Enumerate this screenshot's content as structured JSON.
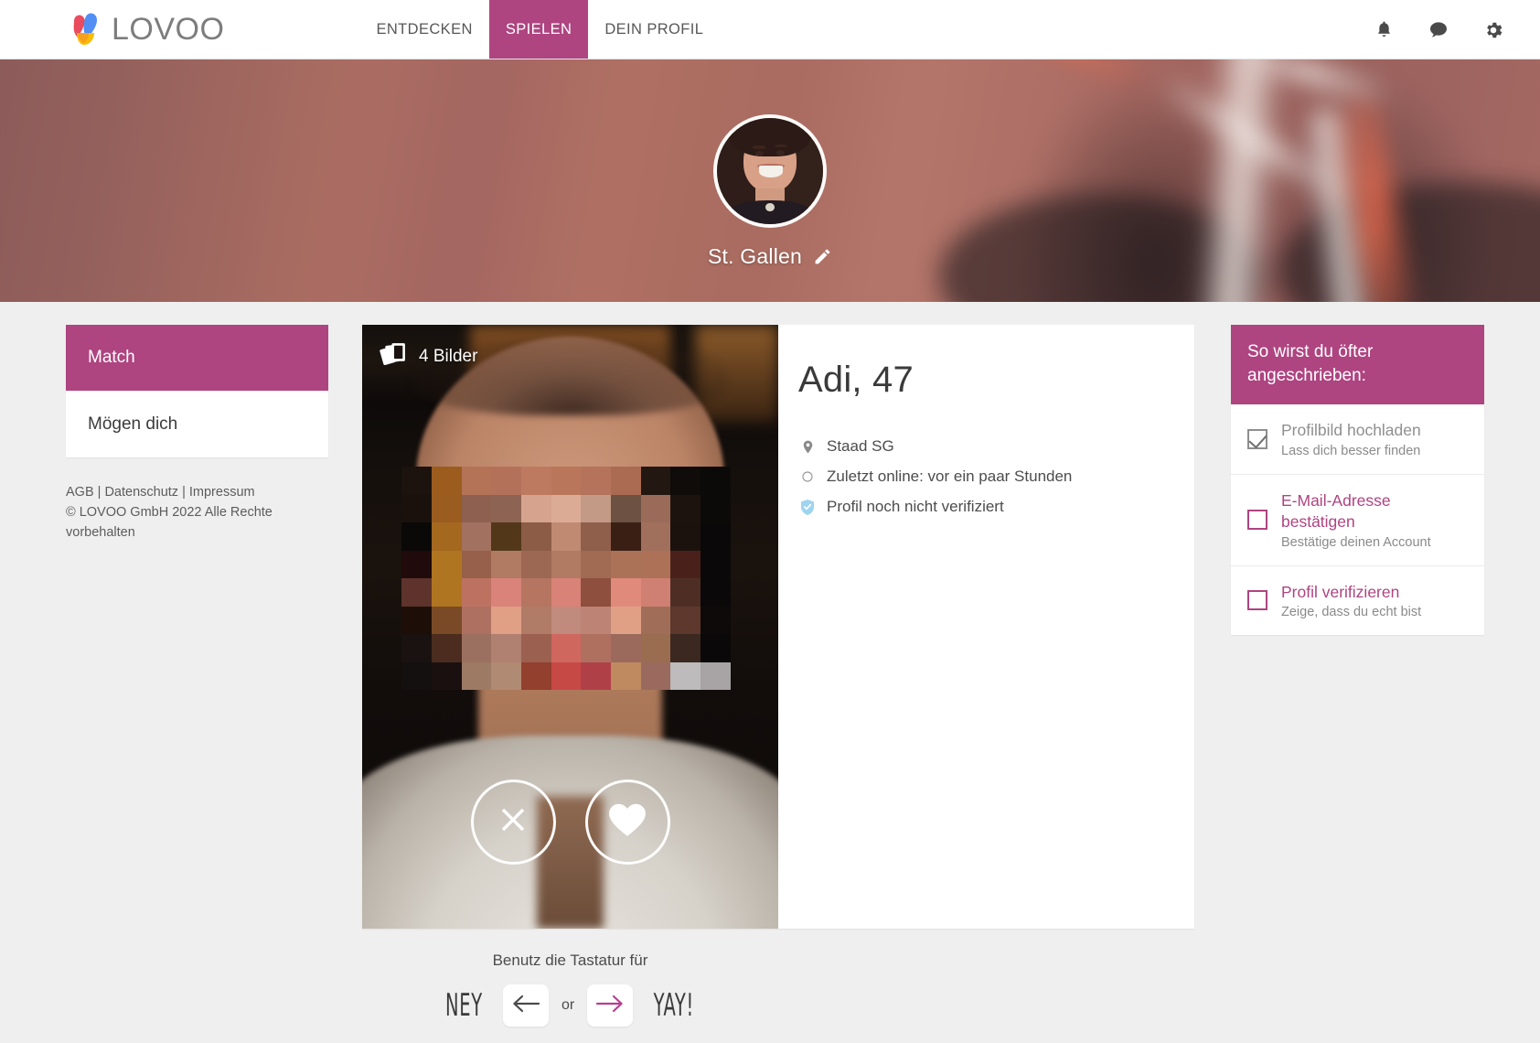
{
  "brand": {
    "name": "LOVOO",
    "accent": "#ae4480",
    "logo_icon": "lovoo-logo-icon"
  },
  "topnav": {
    "items": [
      {
        "label": "ENTDECKEN",
        "active": false
      },
      {
        "label": "SPIELEN",
        "active": true
      },
      {
        "label": "DEIN PROFIL",
        "active": false
      }
    ],
    "icons": [
      {
        "name": "notifications-bell-icon"
      },
      {
        "name": "chat-bubble-icon"
      },
      {
        "name": "settings-gear-icon"
      }
    ]
  },
  "hero": {
    "location": "St. Gallen",
    "edit_icon": "pencil-edit-icon",
    "avatar_icon": "user-avatar"
  },
  "sidebar": {
    "items": [
      {
        "label": "Match",
        "active": true
      },
      {
        "label": "Mögen dich",
        "active": false
      }
    ],
    "legal_links": [
      "AGB",
      "Datenschutz",
      "Impressum"
    ],
    "legal_separator": " | ",
    "copyright": "© LOVOO GmbH 2022 Alle Rechte vorbehalten"
  },
  "card": {
    "photo_badge": {
      "icon": "photo-stack-icon",
      "label": "4 Bilder"
    },
    "actions": {
      "dislike_icon": "close-x-icon",
      "like_icon": "heart-icon"
    },
    "profile": {
      "name_age": "Adi, 47",
      "details": [
        {
          "icon": "location-pin-icon",
          "text": "Staad SG"
        },
        {
          "icon": "clock-circle-icon",
          "text": "Zuletzt online: vor ein paar Stunden"
        },
        {
          "icon": "shield-check-icon",
          "text": "Profil noch nicht verifiziert"
        }
      ]
    }
  },
  "keyboard_hint": {
    "text": "Benutz die Tastatur für",
    "left_word": "NEY",
    "left_key_icon": "arrow-left-icon",
    "or_label": "or",
    "right_key_icon": "arrow-right-icon",
    "right_word": "YAY!"
  },
  "checklist": {
    "title": "So wirst du öfter angeschrieben:",
    "items": [
      {
        "title": "Profilbild hochladen",
        "subtitle": "Lass dich besser finden",
        "checked": true
      },
      {
        "title": "E-Mail-Adresse bestätigen",
        "subtitle": "Bestätige deinen Account",
        "checked": false
      },
      {
        "title": "Profil verifizieren",
        "subtitle": "Zeige, dass du echt bist",
        "checked": false
      }
    ]
  },
  "mosaic_colors": [
    "#1c120e",
    "#9c5c1e",
    "#b47257",
    "#b4715a",
    "#bd7a60",
    "#b9765b",
    "#b4735a",
    "#ab6a52",
    "#231711",
    "#0f0c0a",
    "#0c0a09",
    "#1a110d",
    "#9a5c1f",
    "#8e6050",
    "#8d6354",
    "#d5a38e",
    "#dcab95",
    "#c29a85",
    "#6d5143",
    "#9a6b58",
    "#1c130f",
    "#0c0a09",
    "#0b0908",
    "#a4681f",
    "#a2715f",
    "#523718",
    "#8c5c46",
    "#c08a72",
    "#8f5f4c",
    "#3a2014",
    "#a0705c",
    "#1b120e",
    "#0a0808",
    "#200a0c",
    "#b07520",
    "#96604a",
    "#b07a63",
    "#9d6853",
    "#b07a63",
    "#a06a53",
    "#ab7257",
    "#ad7158",
    "#4a211a",
    "#0b0809",
    "#5e332b",
    "#b07520",
    "#bd7261",
    "#d9837a",
    "#b57560",
    "#d98278",
    "#8f4f3e",
    "#e08a7c",
    "#cf8072",
    "#4e2e24",
    "#0a0808",
    "#1d0f08",
    "#7a4a26",
    "#ae7060",
    "#e0a085",
    "#b07c68",
    "#c08a7c",
    "#bd8475",
    "#e0a085",
    "#a06e58",
    "#5e382c",
    "#0e0a09",
    "#1a1210",
    "#4b2c1e",
    "#9c7060",
    "#b08070",
    "#9c6050",
    "#d0675f",
    "#b07060",
    "#9c6a5c",
    "#9a6c50",
    "#3b2820",
    "#0a0809",
    "#141010",
    "#1a1010",
    "#9c7a64",
    "#b08a72",
    "#93402e",
    "#c74946",
    "#b04048",
    "#c08a60",
    "#9a6a5e",
    "#bdbbbc",
    "#a8a4a6"
  ]
}
